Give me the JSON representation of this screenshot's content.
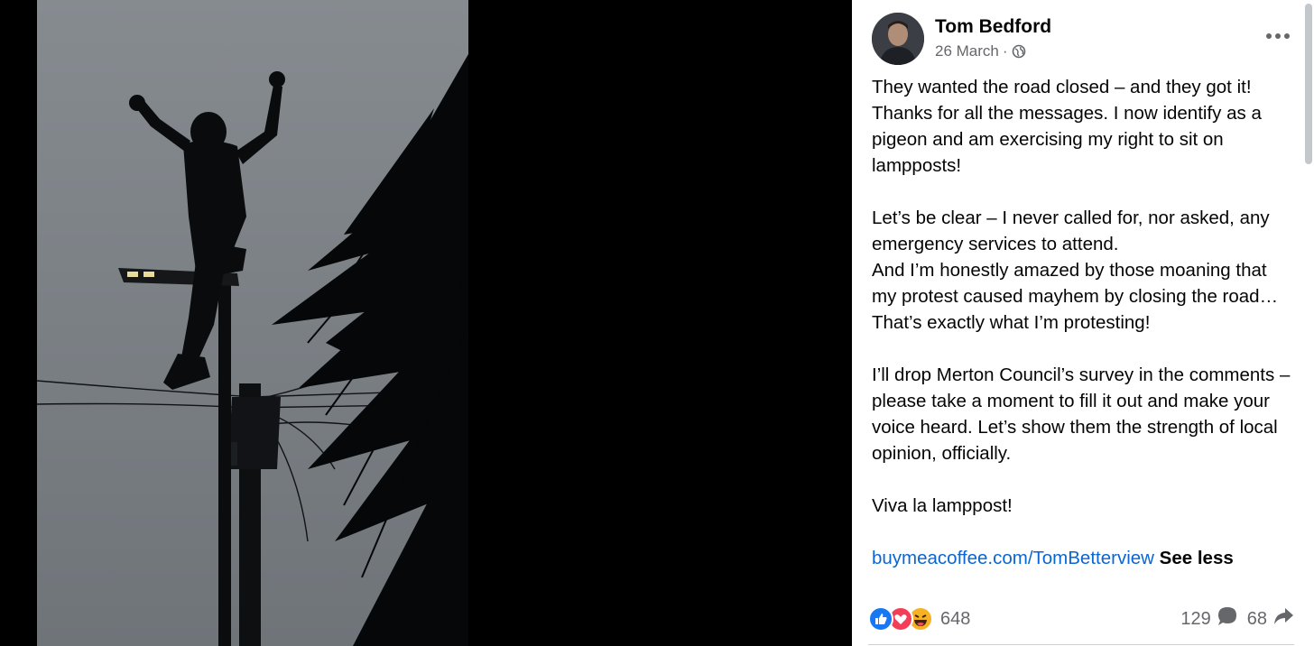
{
  "post": {
    "author": "Tom Bedford",
    "date": "26 March",
    "separator": "·",
    "privacy_icon": "globe-icon",
    "more_icon": "more-options-icon",
    "paragraphs": [
      "They wanted the road closed – and they got it! Thanks for all the messages. I now identify as a pigeon and am exercising my right to sit on lampposts!",
      "Let’s be clear – I never called for, nor asked, any emergency services to attend.",
      "And I’m honestly amazed by those moaning that my protest caused mayhem by closing the road… That’s exactly what I’m protesting!",
      "I’ll drop Merton Council’s survey in the comments – please take a moment to fill it out and make your voice heard. Let’s show them the strength of local opinion, officially.",
      "Viva la lamppost!"
    ],
    "link": "buymeacoffee.com/TomBetterview",
    "see_less": "See less"
  },
  "engagement": {
    "reactions_count": "648",
    "reaction_icons": [
      "like-icon",
      "love-icon",
      "haha-icon"
    ],
    "comments_count": "129",
    "shares_count": "68"
  },
  "colors": {
    "link": "#0a66d2",
    "like": "#1877f2",
    "love": "#f33e58",
    "haha": "#f7b125",
    "secondary_text": "#65676b",
    "sky": "#7f8489"
  }
}
